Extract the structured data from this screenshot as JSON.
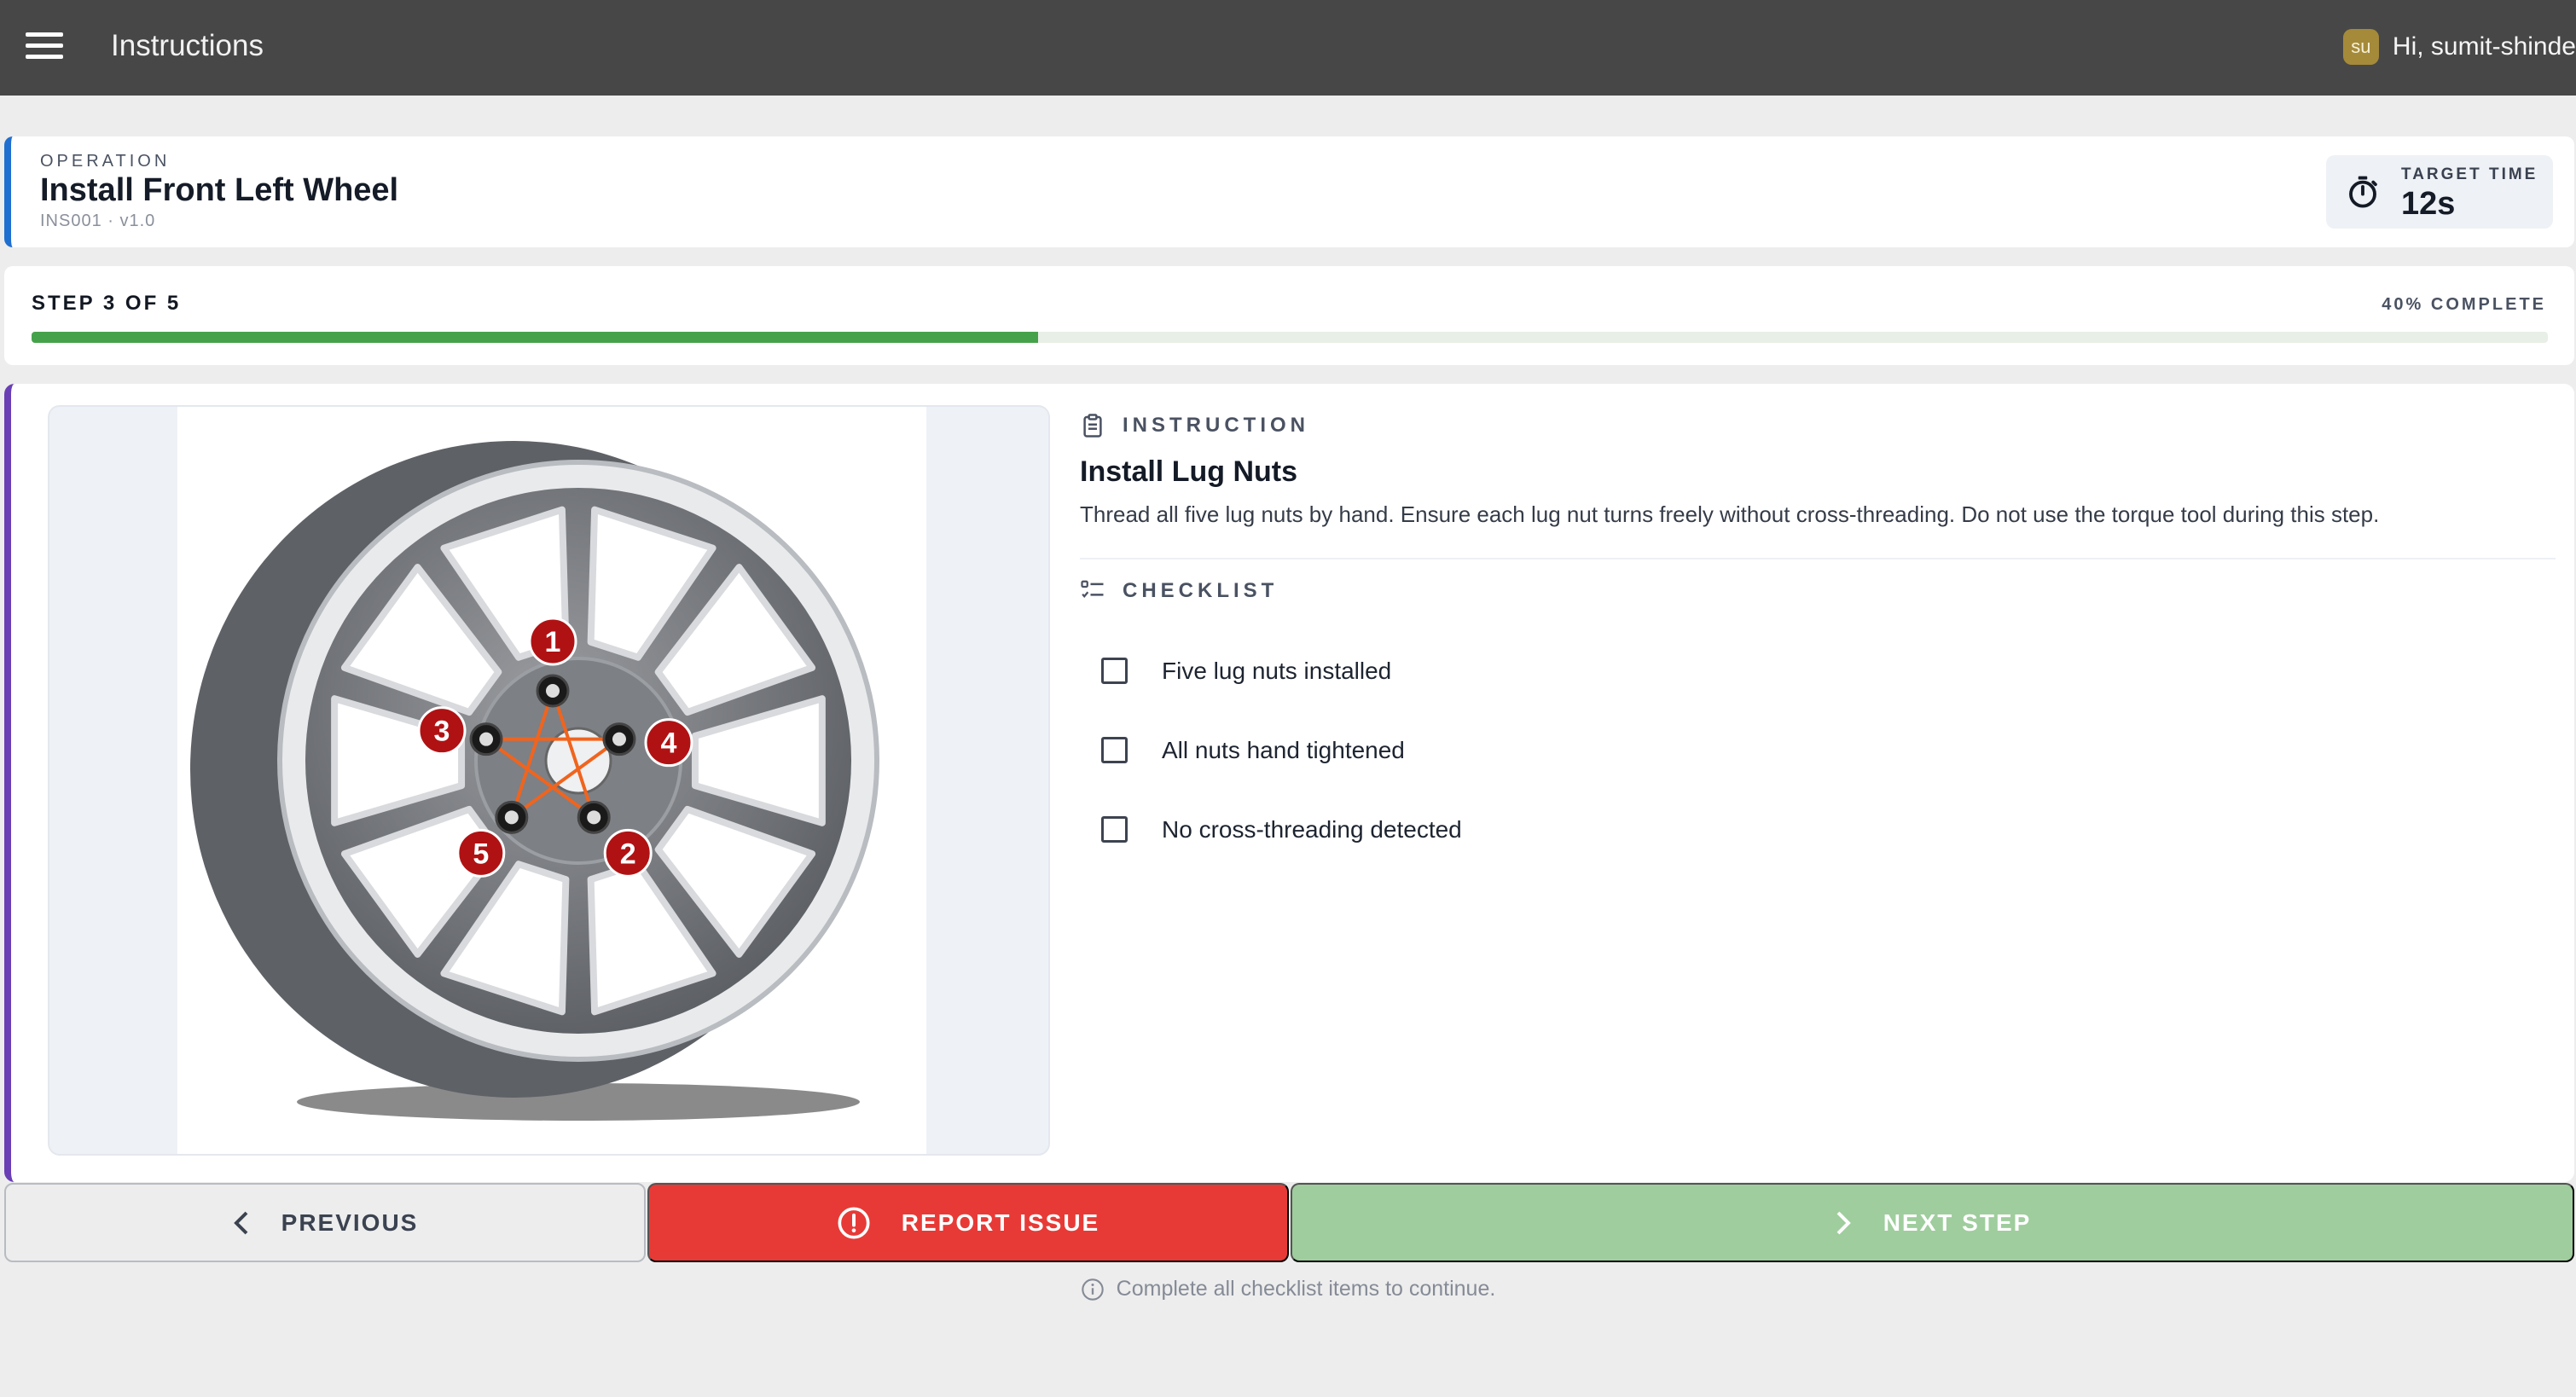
{
  "app": {
    "title": "Instructions",
    "user_initials": "su",
    "greeting": "Hi, sumit-shinde"
  },
  "operation": {
    "label": "OPERATION",
    "title": "Install Front Left Wheel",
    "code": "INS001",
    "version": "v1.0",
    "meta": "INS001  ·  v1.0",
    "target_label": "TARGET TIME",
    "target_value": "12s"
  },
  "progress": {
    "step_text": "STEP 3 OF 5",
    "percent_text": "40% COMPLETE",
    "percent": 40
  },
  "instruction": {
    "section_label": "INSTRUCTION",
    "title": "Install Lug Nuts",
    "body": "Thread all five lug nuts by hand. Ensure each lug nut turns freely without cross-threading. Do not use the torque tool during this step."
  },
  "checklist": {
    "section_label": "CHECKLIST",
    "items": [
      {
        "label": "Five lug nuts installed",
        "checked": false
      },
      {
        "label": "All nuts hand tightened",
        "checked": false
      },
      {
        "label": "No cross-threading detected",
        "checked": false
      }
    ]
  },
  "image": {
    "markers": [
      "1",
      "2",
      "3",
      "4",
      "5"
    ]
  },
  "actions": {
    "previous": "PREVIOUS",
    "report": "REPORT ISSUE",
    "next": "NEXT STEP",
    "hint": "Complete all checklist items to continue."
  },
  "colors": {
    "appbar": "#474747",
    "operation_accent": "#1f6fd0",
    "main_accent": "#6a3fb5",
    "progress_fill": "#45a24a",
    "report": "#e73a36",
    "next_disabled": "#9fcd9d",
    "marker": "#b01214"
  }
}
